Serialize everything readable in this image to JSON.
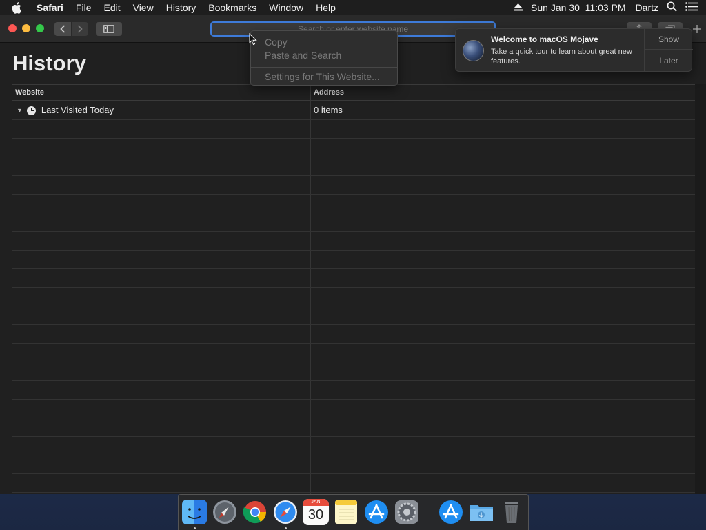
{
  "menubar": {
    "app_name": "Safari",
    "items": [
      "File",
      "Edit",
      "View",
      "History",
      "Bookmarks",
      "Window",
      "Help"
    ],
    "clock": "Sun Jan 30  11:03 PM",
    "user": "Dartz"
  },
  "toolbar": {
    "address_placeholder": "Search or enter website name"
  },
  "page": {
    "title": "History",
    "columns": [
      "Website",
      "Address"
    ],
    "rows": [
      {
        "website": "Last Visited Today",
        "address": "0 items"
      }
    ]
  },
  "context_menu": {
    "items": [
      "Copy",
      "Paste and Search",
      "Settings for This Website..."
    ]
  },
  "notification": {
    "title": "Welcome to macOS Mojave",
    "body": "Take a quick tour to learn about great new features.",
    "show_label": "Show",
    "later_label": "Later"
  },
  "dock": {
    "calendar_month": "JAN",
    "calendar_day": "30"
  },
  "colors": {
    "accent": "#3e7bd9",
    "close": "#fc5753",
    "minimize": "#fdbc40",
    "zoom": "#34c84a"
  }
}
